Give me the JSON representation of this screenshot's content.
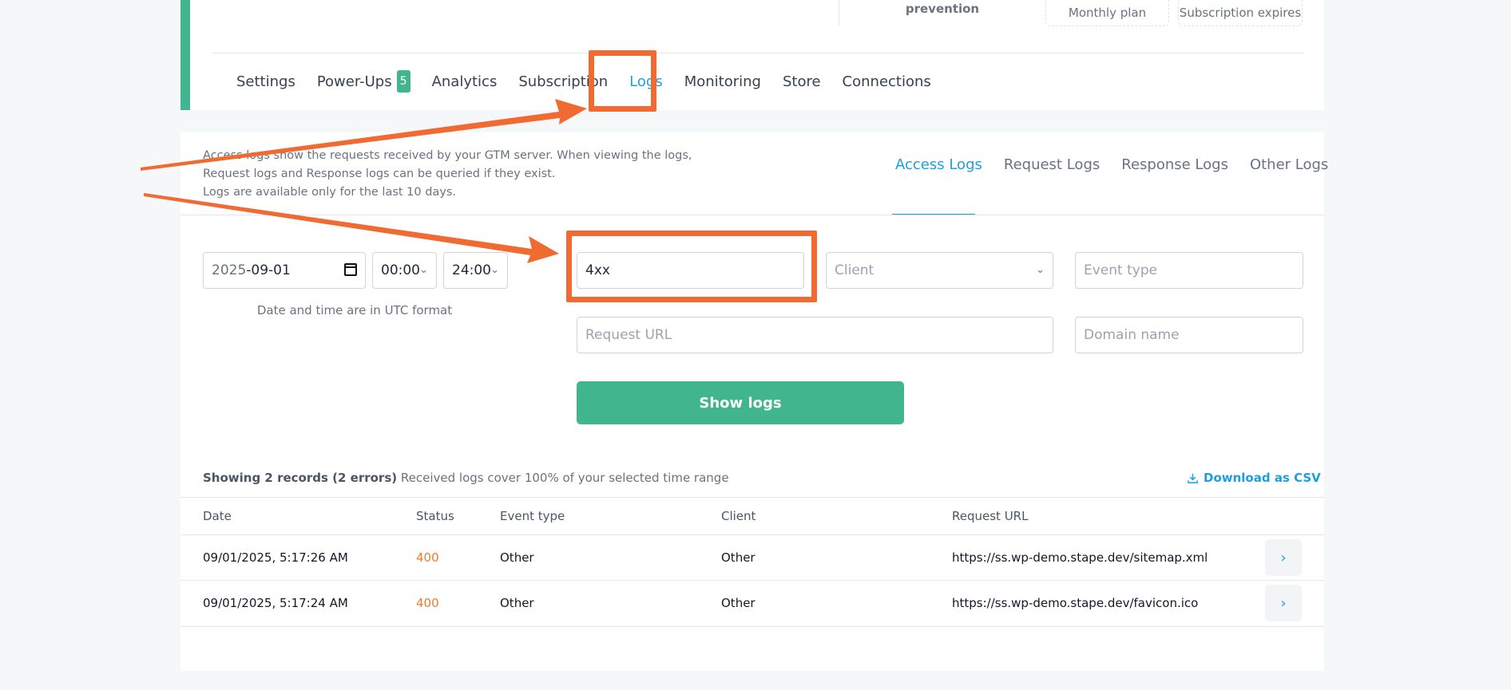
{
  "header": {
    "stats": [
      "prevention",
      "Monthly plan",
      "Subscription expires"
    ]
  },
  "tabs": [
    {
      "label": "Settings",
      "active": false
    },
    {
      "label": "Power-Ups",
      "active": false,
      "badge": "5"
    },
    {
      "label": "Analytics",
      "active": false
    },
    {
      "label": "Subscription",
      "active": false
    },
    {
      "label": "Logs",
      "active": true
    },
    {
      "label": "Monitoring",
      "active": false
    },
    {
      "label": "Store",
      "active": false
    },
    {
      "label": "Connections",
      "active": false
    }
  ],
  "description": [
    "Access logs show the requests received by your GTM server. When viewing the logs,",
    "Request logs and Response logs can be queried if they exist.",
    "Logs are available only for the last 10 days."
  ],
  "subtabs": [
    {
      "label": "Access Logs",
      "active": true
    },
    {
      "label": "Request Logs",
      "active": false
    },
    {
      "label": "Response Logs",
      "active": false
    },
    {
      "label": "Other Logs",
      "active": false
    }
  ],
  "filters": {
    "date_year": "2025",
    "date_rest": "-09-01",
    "time_from": "00:00",
    "time_to": "24:00",
    "utc_note": "Date and time are in UTC format",
    "status_value": "4xx",
    "client_placeholder": "Client",
    "event_type_placeholder": "Event type",
    "request_url_placeholder": "Request URL",
    "domain_placeholder": "Domain name"
  },
  "show_logs_label": "Show logs",
  "summary": {
    "bold": "Showing 2 records (2 errors)",
    "rest": "Received logs cover 100% of your selected time range",
    "download": "Download as CSV"
  },
  "table": {
    "headers": [
      "Date",
      "Status",
      "Event type",
      "Client",
      "Request URL"
    ],
    "rows": [
      {
        "date": "09/01/2025, 5:17:26 AM",
        "status": "400",
        "event_type": "Other",
        "client": "Other",
        "url": "https://ss.wp-demo.stape.dev/sitemap.xml"
      },
      {
        "date": "09/01/2025, 5:17:24 AM",
        "status": "400",
        "event_type": "Other",
        "client": "Other",
        "url": "https://ss.wp-demo.stape.dev/favicon.ico"
      }
    ]
  },
  "colors": {
    "accent_green": "#41b58e",
    "link_blue": "#1ca0dc",
    "status_orange": "#f07a2c",
    "annotation_orange": "#f06a32"
  },
  "icons": {
    "calendar": "calendar-icon",
    "chevron": "chevron-down-icon",
    "download": "download-icon",
    "row_open": "chevron-right-icon"
  }
}
